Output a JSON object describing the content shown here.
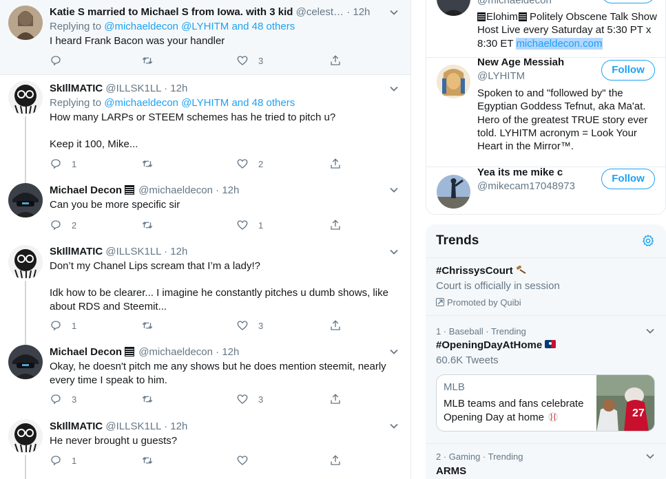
{
  "timeline": {
    "tweets": [
      {
        "name": "Katie S married to Michael S from Iowa. with 3 kid",
        "handle": "@celest…",
        "time": "· 12h",
        "reply_prefix": "Replying to",
        "reply_links": "@michaeldecon @LYHITM and 48 others",
        "text": [
          "I heard Frank Bacon was your handler"
        ],
        "counts": {
          "reply": "",
          "retweet": "",
          "like": "3"
        }
      },
      {
        "name": "SkIllMATIC",
        "handle": "@ILLSK1LL",
        "time": "· 12h",
        "reply_prefix": "Replying to",
        "reply_links": "@michaeldecon @LYHITM and 48 others",
        "text": [
          "How many LARPs or STEEM schemes has he tried to pitch u?",
          "",
          "Keep it 100, Mike..."
        ],
        "counts": {
          "reply": "1",
          "retweet": "",
          "like": "2"
        }
      },
      {
        "name": "Michael Decon",
        "handle": "@michaeldecon",
        "time": "· 12h",
        "text": [
          "Can you be more specific sir"
        ],
        "counts": {
          "reply": "2",
          "retweet": "",
          "like": "1"
        }
      },
      {
        "name": "SkIllMATIC",
        "handle": "@ILLSK1LL",
        "time": "· 12h",
        "text": [
          "Don’t my Chanel Lips scream that I’m a lady!?",
          "",
          "Idk how to be clearer... I imagine he constantly pitches u dumb shows, like about RDS and Steemit..."
        ],
        "counts": {
          "reply": "1",
          "retweet": "",
          "like": "3"
        }
      },
      {
        "name": "Michael Decon",
        "handle": "@michaeldecon",
        "time": "· 12h",
        "text": [
          "Okay, he doesn't pitch me any shows but he does mention steemit, nearly every time I speak to him."
        ],
        "counts": {
          "reply": "3",
          "retweet": "",
          "like": "3"
        }
      },
      {
        "name": "SkIllMATIC",
        "handle": "@ILLSK1LL",
        "time": "· 12h",
        "text": [
          "He never brought u guests?"
        ],
        "counts": {
          "reply": "1",
          "retweet": "",
          "like": ""
        }
      }
    ]
  },
  "who_to_follow": {
    "first": {
      "handle_partial": "@michaeldecon",
      "bio_1": "Elohim",
      "bio_2": " Politely Obscene Talk Show Host Live every Saturday at 5:30 PT x 8:30 ET ",
      "bio_link": "michaeldecon.com"
    },
    "second": {
      "name": "New Age Messiah",
      "handle": "@LYHITM",
      "bio": "Spoken to and \"followed by\" the Egyptian Goddess Tefnut, aka Ma'at. Hero of the greatest TRUE story ever told. LYHITM acronym = Look Your Heart in the Mirror™.",
      "follow_label": "Follow"
    },
    "third": {
      "name": "Yea its me mike c",
      "handle": "@mikecam17048973",
      "follow_label": "Follow"
    }
  },
  "trends": {
    "title": "Trends",
    "promoted": {
      "name": "#ChrissysCourt",
      "desc": "Court is officially in session",
      "promoted_label": "Promoted by Quibi"
    },
    "items": [
      {
        "meta": "1 · Baseball · Trending",
        "name": "#OpeningDayAtHome",
        "count": "60.6K Tweets",
        "news_source": "MLB",
        "news_headline": "MLB teams and fans celebrate Opening Day at home"
      },
      {
        "meta": "2 · Gaming · Trending",
        "name": "ARMS"
      }
    ]
  },
  "colors": {
    "accent": "#1da1f2",
    "muted": "#657786",
    "text": "#14171a",
    "highlight_bg": "#f5f8fa",
    "border": "#e6ecf0"
  }
}
